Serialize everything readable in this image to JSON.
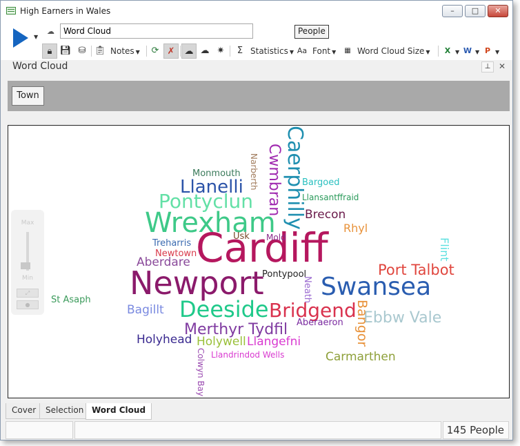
{
  "window": {
    "title": "High Earners in Wales",
    "min_label": "–",
    "max_label": "□",
    "close_label": "✕"
  },
  "toolbar": {
    "name_value": "Word Cloud",
    "people_label": "People",
    "notes_label": "Notes",
    "statistics_label": "Statistics",
    "font_label": "Font",
    "size_label": "Word Cloud Size"
  },
  "panel": {
    "title": "Word Cloud",
    "pin_label": "⊥",
    "close_label": "✕"
  },
  "group": {
    "town_label": "Town"
  },
  "zoom": {
    "max_label": "Max",
    "min_label": "Min"
  },
  "tabs": [
    {
      "label": "Cover"
    },
    {
      "label": "Selection"
    },
    {
      "label": "Word Cloud"
    }
  ],
  "status": {
    "count": "145 People"
  },
  "words": [
    {
      "text": "Cardiff",
      "color": "#b5175e",
      "size": 58
    },
    {
      "text": "Newport",
      "color": "#8b1a6b",
      "size": 46
    },
    {
      "text": "Swansea",
      "color": "#2a5db0",
      "size": 36
    },
    {
      "text": "Wrexham",
      "color": "#3ec988",
      "size": 40
    },
    {
      "text": "Caerphilly",
      "color": "#1f8fb0",
      "size": 30
    },
    {
      "text": "Cwmbran",
      "color": "#a02ab0",
      "size": 22
    },
    {
      "text": "Deeside",
      "color": "#1fc98a",
      "size": 32
    },
    {
      "text": "Bridgend",
      "color": "#d9324e",
      "size": 28
    },
    {
      "text": "Pontyclun",
      "color": "#63e0a6",
      "size": 28
    },
    {
      "text": "Llanelli",
      "color": "#2b53a8",
      "size": 26
    },
    {
      "text": "Merthyr Tydfil",
      "color": "#7f3aa0",
      "size": 22
    },
    {
      "text": "Port Talbot",
      "color": "#e0463e",
      "size": 21
    },
    {
      "text": "Ebbw Vale",
      "color": "#a9c8cf",
      "size": 22
    },
    {
      "text": "Bangor",
      "color": "#e8923a",
      "size": 19
    },
    {
      "text": "Carmarthen",
      "color": "#8ea03a",
      "size": 17
    },
    {
      "text": "Brecon",
      "color": "#6a1a4a",
      "size": 17
    },
    {
      "text": "Holyhead",
      "color": "#3a2a90",
      "size": 17
    },
    {
      "text": "Holywell",
      "color": "#9ac03a",
      "size": 17
    },
    {
      "text": "Llangefni",
      "color": "#d93ad0",
      "size": 17
    },
    {
      "text": "Aberdare",
      "color": "#8a4a9a",
      "size": 17
    },
    {
      "text": "Bagillt",
      "color": "#7a8ae0",
      "size": 17
    },
    {
      "text": "Rhyl",
      "color": "#e8923a",
      "size": 16
    },
    {
      "text": "Flint",
      "color": "#5de0e0",
      "size": 16
    },
    {
      "text": "Monmouth",
      "color": "#3a7a5a",
      "size": 13
    },
    {
      "text": "Narberth",
      "color": "#a07a5a",
      "size": 12
    },
    {
      "text": "Bargoed",
      "color": "#2ac0c0",
      "size": 13
    },
    {
      "text": "Llansantffraid",
      "color": "#2a9a5a",
      "size": 12
    },
    {
      "text": "Treharris",
      "color": "#3a6ab0",
      "size": 13
    },
    {
      "text": "Usk",
      "color": "#7a4a2a",
      "size": 13
    },
    {
      "text": "Mold",
      "color": "#8a2a8a",
      "size": 12
    },
    {
      "text": "Newtown",
      "color": "#d93a4a",
      "size": 13
    },
    {
      "text": "Pontypool",
      "color": "#222222",
      "size": 13
    },
    {
      "text": "Neath",
      "color": "#9a6ad0",
      "size": 13
    },
    {
      "text": "Aberaeron",
      "color": "#7a2aa0",
      "size": 13
    },
    {
      "text": "Llandrindod Wells",
      "color": "#d93ad0",
      "size": 12
    },
    {
      "text": "Colwyn Bay",
      "color": "#9a4ab0",
      "size": 12
    },
    {
      "text": "St Asaph",
      "color": "#3a9a5a",
      "size": 13
    }
  ]
}
